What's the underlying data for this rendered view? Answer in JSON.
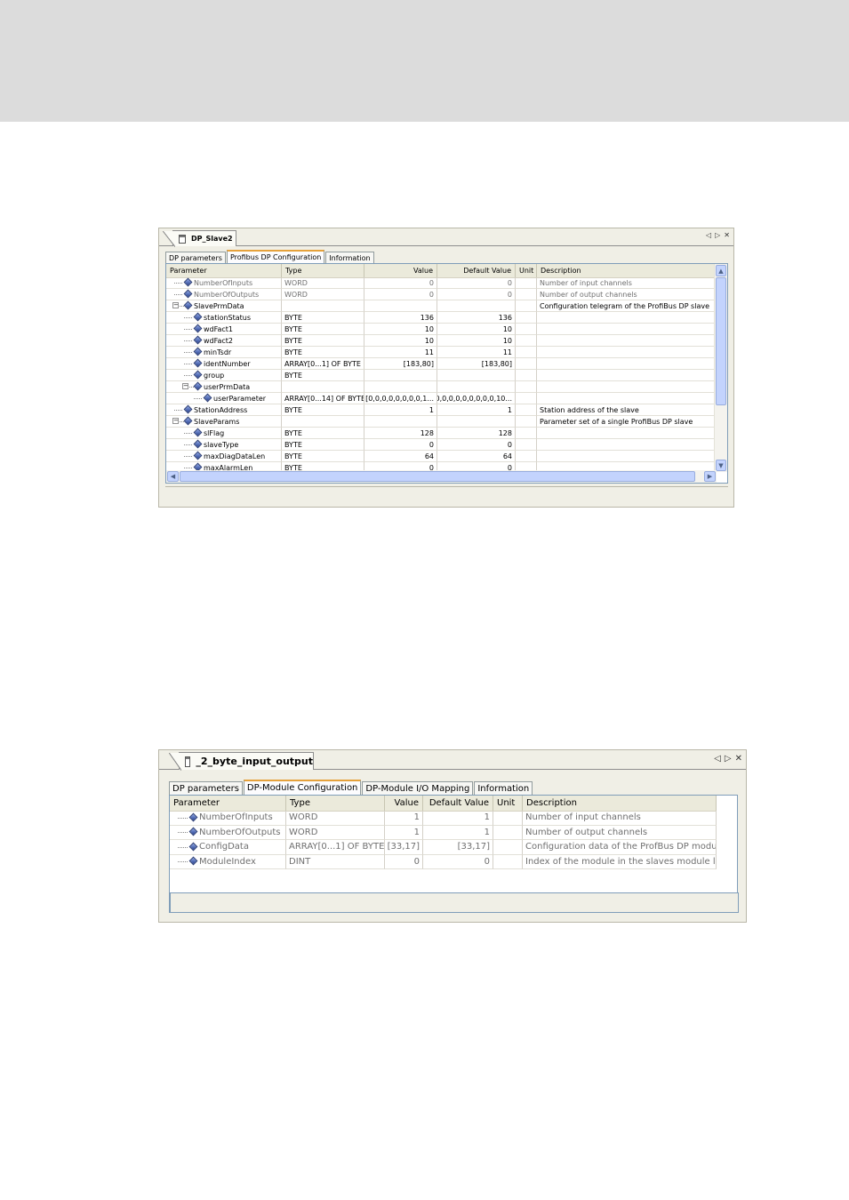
{
  "panel1": {
    "title": "DP_Slave2",
    "tabs": [
      "DP parameters",
      "Profibus DP Configuration",
      "Information"
    ],
    "active_tab": 1,
    "columns": [
      "Parameter",
      "Type",
      "Value",
      "Default Value",
      "Unit",
      "Description"
    ],
    "rows": [
      {
        "name": "NumberOfInputs",
        "type": "WORD",
        "value": "0",
        "default": "0",
        "unit": "",
        "desc": "Number of input channels",
        "gray": true,
        "level": 0,
        "expander": ""
      },
      {
        "name": "NumberOfOutputs",
        "type": "WORD",
        "value": "0",
        "default": "0",
        "unit": "",
        "desc": "Number of output channels",
        "gray": true,
        "level": 0,
        "expander": ""
      },
      {
        "name": "SlavePrmData",
        "type": "",
        "value": "",
        "default": "",
        "unit": "",
        "desc": "Configuration telegram of the ProfiBus DP slave",
        "gray": false,
        "level": 0,
        "expander": "−"
      },
      {
        "name": "stationStatus",
        "type": "BYTE",
        "value": "136",
        "default": "136",
        "unit": "",
        "desc": "",
        "gray": false,
        "level": 1,
        "expander": ""
      },
      {
        "name": "wdFact1",
        "type": "BYTE",
        "value": "10",
        "default": "10",
        "unit": "",
        "desc": "",
        "gray": false,
        "level": 1,
        "expander": ""
      },
      {
        "name": "wdFact2",
        "type": "BYTE",
        "value": "10",
        "default": "10",
        "unit": "",
        "desc": "",
        "gray": false,
        "level": 1,
        "expander": ""
      },
      {
        "name": "minTsdr",
        "type": "BYTE",
        "value": "11",
        "default": "11",
        "unit": "",
        "desc": "",
        "gray": false,
        "level": 1,
        "expander": ""
      },
      {
        "name": "identNumber",
        "type": "ARRAY[0...1] OF BYTE",
        "value": "[183,80]",
        "default": "[183,80]",
        "unit": "",
        "desc": "",
        "gray": false,
        "level": 1,
        "expander": ""
      },
      {
        "name": "group",
        "type": "BYTE",
        "value": "",
        "default": "",
        "unit": "",
        "desc": "",
        "gray": false,
        "level": 1,
        "expander": ""
      },
      {
        "name": "userPrmData",
        "type": "",
        "value": "",
        "default": "",
        "unit": "",
        "desc": "",
        "gray": false,
        "level": 1,
        "expander": "−"
      },
      {
        "name": "userParameter",
        "type": "ARRAY[0...14] OF BYTE",
        "value": "[0,0,0,0,0,0,0,0,1...",
        "default": "[0,0,0,0,0,0,0,0,0,10...",
        "unit": "",
        "desc": "",
        "gray": false,
        "level": 2,
        "expander": ""
      },
      {
        "name": "StationAddress",
        "type": "BYTE",
        "value": "1",
        "default": "1",
        "unit": "",
        "desc": "Station address of the slave",
        "gray": false,
        "level": 0,
        "expander": ""
      },
      {
        "name": "SlaveParams",
        "type": "",
        "value": "",
        "default": "",
        "unit": "",
        "desc": "Parameter set of a single ProfiBus DP slave",
        "gray": false,
        "level": 0,
        "expander": "−"
      },
      {
        "name": "slFlag",
        "type": "BYTE",
        "value": "128",
        "default": "128",
        "unit": "",
        "desc": "",
        "gray": false,
        "level": 1,
        "expander": ""
      },
      {
        "name": "slaveType",
        "type": "BYTE",
        "value": "0",
        "default": "0",
        "unit": "",
        "desc": "",
        "gray": false,
        "level": 1,
        "expander": ""
      },
      {
        "name": "maxDiagDataLen",
        "type": "BYTE",
        "value": "64",
        "default": "64",
        "unit": "",
        "desc": "",
        "gray": false,
        "level": 1,
        "expander": ""
      },
      {
        "name": "maxAlarmLen",
        "type": "BYTE",
        "value": "0",
        "default": "0",
        "unit": "",
        "desc": "",
        "gray": false,
        "level": 1,
        "expander": ""
      }
    ]
  },
  "panel2": {
    "title": "_2_byte_input_output",
    "tabs": [
      "DP parameters",
      "DP-Module Configuration",
      "DP-Module I/O Mapping",
      "Information"
    ],
    "active_tab": 1,
    "columns": [
      "Parameter",
      "Type",
      "Value",
      "Default Value",
      "Unit",
      "Description"
    ],
    "rows": [
      {
        "name": "NumberOfInputs",
        "type": "WORD",
        "value": "1",
        "default": "1",
        "unit": "",
        "desc": "Number of input channels",
        "gray": true,
        "level": 0,
        "expander": ""
      },
      {
        "name": "NumberOfOutputs",
        "type": "WORD",
        "value": "1",
        "default": "1",
        "unit": "",
        "desc": "Number of output channels",
        "gray": true,
        "level": 0,
        "expander": ""
      },
      {
        "name": "ConfigData",
        "type": "ARRAY[0...1] OF BYTE",
        "value": "[33,17]",
        "default": "[33,17]",
        "unit": "",
        "desc": "Configuration data of the ProfBus DP module",
        "gray": true,
        "level": 0,
        "expander": ""
      },
      {
        "name": "ModuleIndex",
        "type": "DINT",
        "value": "0",
        "default": "0",
        "unit": "",
        "desc": "Index of the module in the slaves module list",
        "gray": true,
        "level": 0,
        "expander": ""
      }
    ]
  },
  "window_controls": [
    "◁",
    "▷",
    "✕"
  ]
}
